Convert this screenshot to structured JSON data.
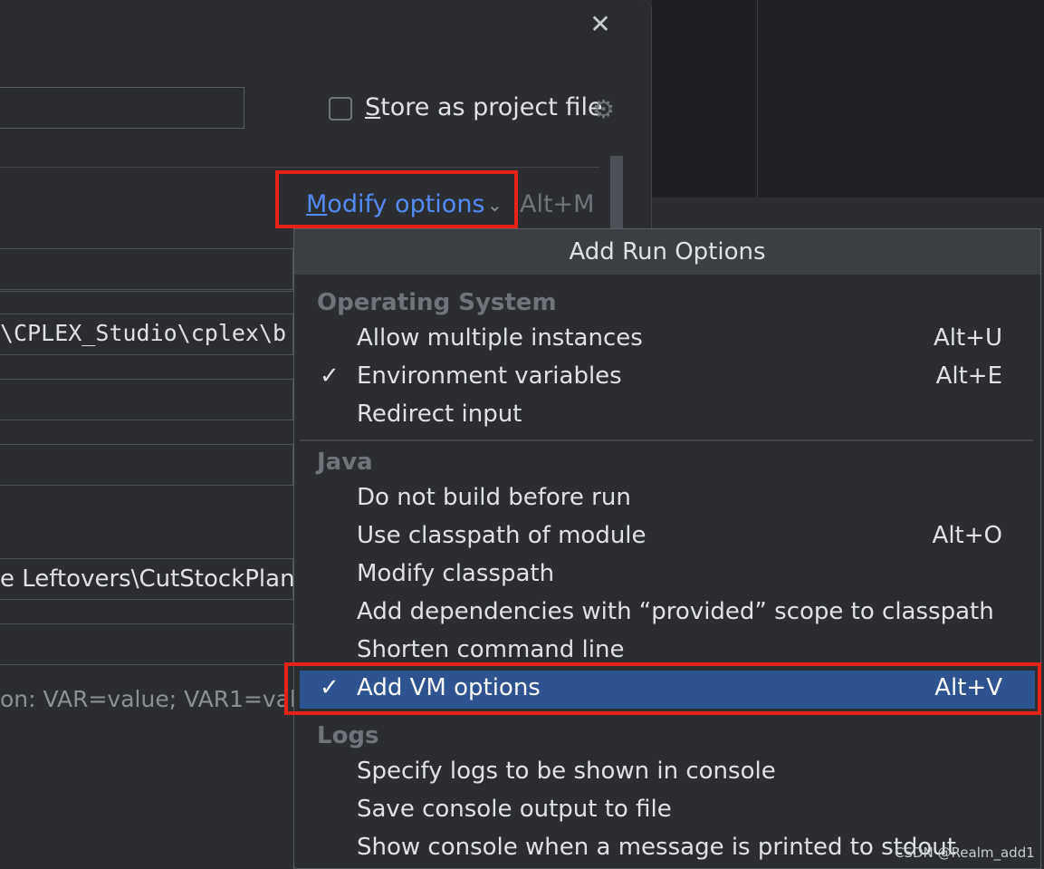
{
  "dialog": {
    "store_as_project_file": "Store as project file",
    "store_mnemonic": "S",
    "store_rest": "tore as project file",
    "modify_options_mnemonic": "M",
    "modify_options_rest": "odify options",
    "modify_options_shortcut": "Alt+M",
    "path_field_text": "\\CPLEX_Studio\\cplex\\b",
    "working_dir_text": "e Leftovers\\CutStockPlann",
    "env_hint_text": "on: VAR=value; VAR1=val"
  },
  "popup": {
    "title": "Add Run Options",
    "groups": [
      {
        "title": "Operating System",
        "items": [
          {
            "label": "Allow multiple instances",
            "shortcut": "Alt+U",
            "checked": false
          },
          {
            "label": "Environment variables",
            "shortcut": "Alt+E",
            "checked": true
          },
          {
            "label": "Redirect input",
            "shortcut": "",
            "checked": false
          }
        ]
      },
      {
        "title": "Java",
        "items": [
          {
            "label": "Do not build before run",
            "shortcut": "",
            "checked": false
          },
          {
            "label": "Use classpath of module",
            "shortcut": "Alt+O",
            "checked": false
          },
          {
            "label": "Modify classpath",
            "shortcut": "",
            "checked": false
          },
          {
            "label": "Add dependencies with “provided” scope to classpath",
            "shortcut": "",
            "checked": false
          },
          {
            "label": "Shorten command line",
            "shortcut": "",
            "checked": false
          },
          {
            "label": "Add VM options",
            "shortcut": "Alt+V",
            "checked": true,
            "selected": true
          }
        ]
      },
      {
        "title": "Logs",
        "items": [
          {
            "label": "Specify logs to be shown in console",
            "shortcut": "",
            "checked": false
          },
          {
            "label": "Save console output to file",
            "shortcut": "",
            "checked": false
          },
          {
            "label": "Show console when a message is printed to stdout",
            "shortcut": "",
            "checked": false
          }
        ]
      }
    ]
  },
  "check_glyph": "✓",
  "close_glyph": "✕",
  "gear_glyph": "⚙",
  "chevron_glyph": "⌄",
  "watermark": "CSDN @Realm_add1",
  "colors": {
    "accent_link": "#548af7",
    "highlight_box": "#e8201c",
    "selected_row": "#2e5391"
  }
}
